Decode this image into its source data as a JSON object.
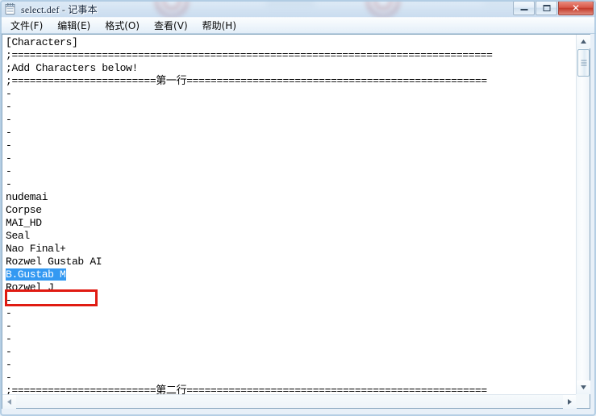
{
  "window": {
    "title": "select.def - 记事本",
    "icon": "notepad-icon",
    "controls": {
      "minimize_label": "最小化",
      "maximize_label": "最大化",
      "close_label": "✕"
    }
  },
  "menubar": {
    "items": [
      {
        "label": "文件(F)"
      },
      {
        "label": "编辑(E)"
      },
      {
        "label": "格式(O)"
      },
      {
        "label": "查看(V)"
      },
      {
        "label": "帮助(H)"
      }
    ]
  },
  "editor": {
    "lines": [
      {
        "text": "[Characters]"
      },
      {
        "text": ";================================================================================"
      },
      {
        "text": ";Add Characters below!"
      },
      {
        "text": ";========================第一行=================================================="
      },
      {
        "text": "-"
      },
      {
        "text": "-"
      },
      {
        "text": "-"
      },
      {
        "text": "-"
      },
      {
        "text": "-"
      },
      {
        "text": "-"
      },
      {
        "text": "-"
      },
      {
        "text": "-"
      },
      {
        "text": "nudemai"
      },
      {
        "text": "Corpse"
      },
      {
        "text": "MAI_HD"
      },
      {
        "text": "Seal"
      },
      {
        "text": "Nao Final+"
      },
      {
        "text": "Rozwel Gustab AI"
      },
      {
        "text": "B.Gustab M",
        "selected": true
      },
      {
        "text": "Rozwel J"
      },
      {
        "text": "-"
      },
      {
        "text": "-"
      },
      {
        "text": "-"
      },
      {
        "text": "-"
      },
      {
        "text": "-"
      },
      {
        "text": "-"
      },
      {
        "text": "-"
      },
      {
        "text": ";========================第二行=================================================="
      }
    ],
    "selection": {
      "text": "B.Gustab M",
      "highlight_color": "#3399f2",
      "text_color": "#ffffff"
    },
    "annotation": {
      "shape": "rectangle",
      "color": "#e01b12",
      "target": "B.Gustab M"
    }
  },
  "scrollbars": {
    "vertical": {
      "up_arrow": "▲",
      "down_arrow": "▼",
      "thumb_position": "top"
    },
    "horizontal": {
      "left_arrow": "◀",
      "right_arrow": "▶"
    }
  }
}
